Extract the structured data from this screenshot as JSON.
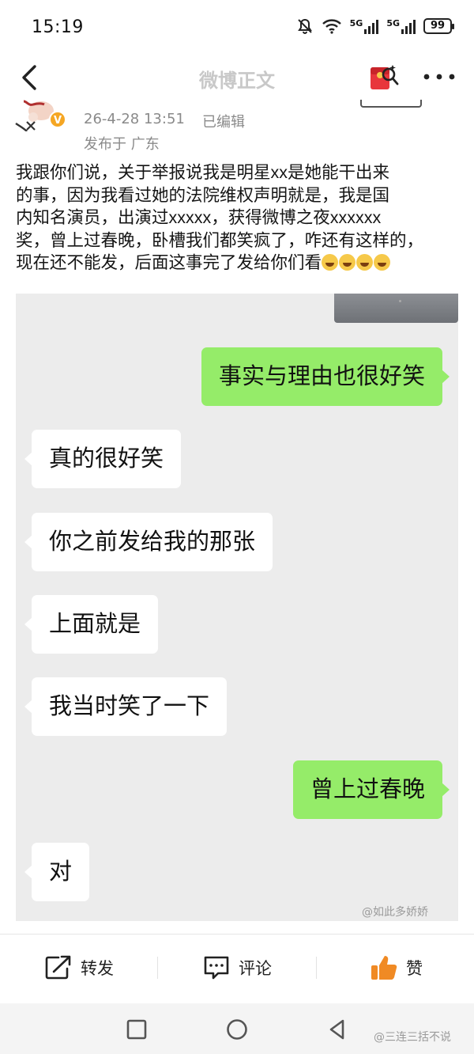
{
  "status_bar": {
    "time": "15:19",
    "net1": "5G",
    "net2": "5G",
    "battery": "99"
  },
  "nav": {
    "title": "微博正文"
  },
  "post": {
    "date": "26-4-28 13:51",
    "edited": "已编辑",
    "location": "发布于 广东",
    "verified_badge": "V",
    "text_lines": [
      "我跟你们说，关于举报说我是明星xx是她能干出来",
      "的事，因为我看过她的法院维权声明就是，我是国",
      "内知名演员，出演过xxxxx，获得微博之夜xxxxxx",
      "奖，曾上过春晚，卧槽我们都笑疯了，咋还有这样的，",
      "现在还不能发，后面这事完了发给你们看"
    ]
  },
  "chat": {
    "messages": [
      {
        "side": "right",
        "text": "事实与理由也很好笑"
      },
      {
        "side": "left",
        "text": "真的很好笑"
      },
      {
        "side": "left",
        "text": "你之前发给我的那张"
      },
      {
        "side": "left",
        "text": "上面就是"
      },
      {
        "side": "left",
        "text": "我当时笑了一下"
      },
      {
        "side": "right",
        "text": "曾上过春晚"
      },
      {
        "side": "left",
        "text": "对"
      }
    ],
    "watermark": "@如此多娇娇"
  },
  "actions": {
    "repost": "转发",
    "comment": "评论",
    "like": "赞"
  },
  "footer_watermark": "@三连三括不说",
  "colors": {
    "bubble_green": "#95ec69",
    "like_orange": "#f08a24",
    "verified": "#f5a623"
  }
}
